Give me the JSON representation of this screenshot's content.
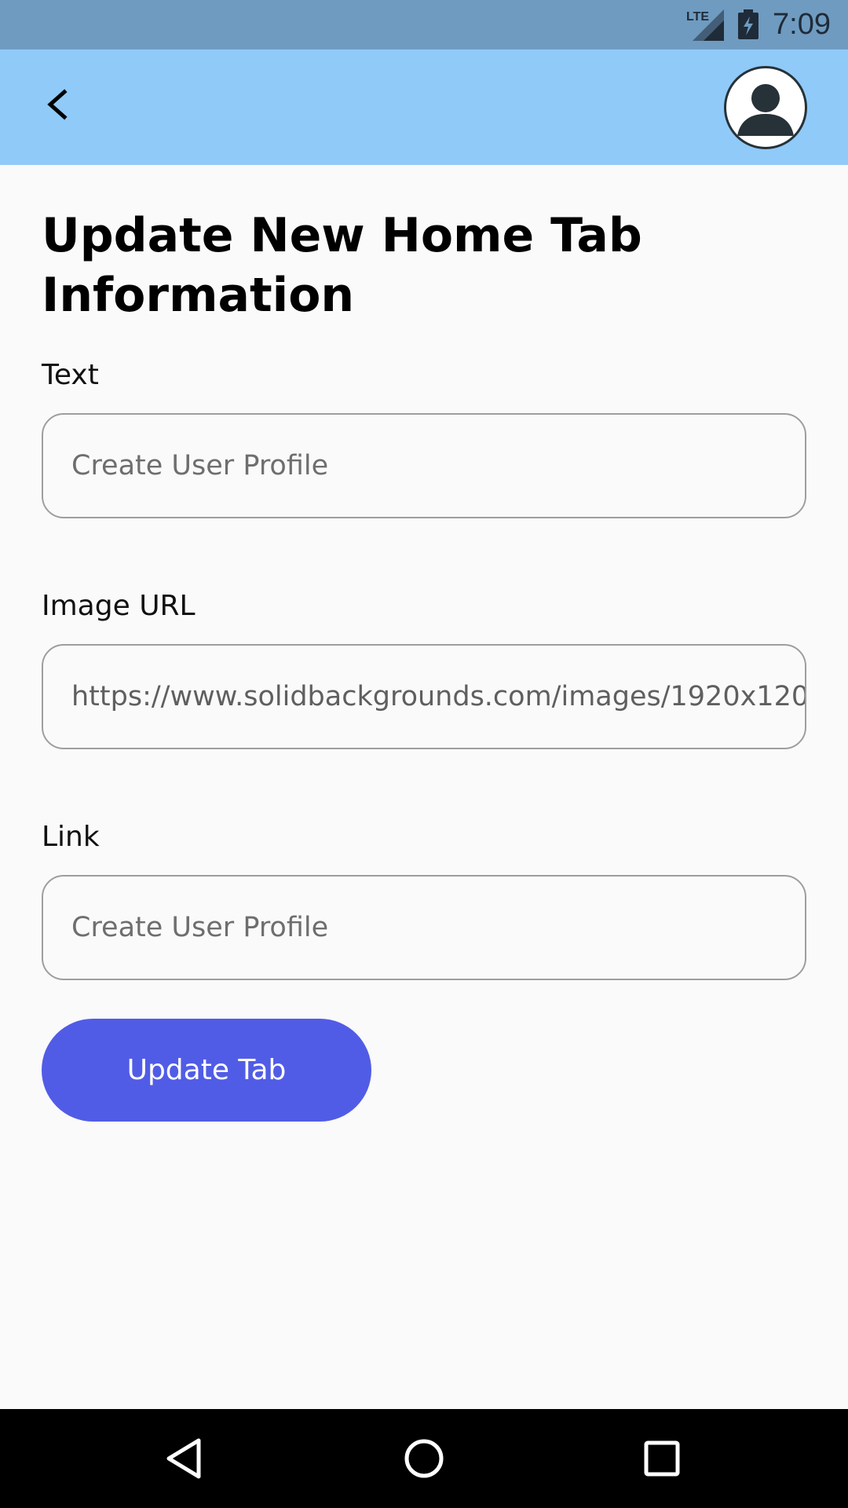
{
  "status_bar": {
    "time": "7:09",
    "network_label": "LTE",
    "icons": [
      "lte-signal-icon",
      "battery-charging-icon"
    ]
  },
  "app_bar": {
    "background": "#90caf9",
    "back_icon": "chevron-left-icon",
    "avatar_icon": "user-avatar-icon"
  },
  "page": {
    "title": "Update New Home Tab Information"
  },
  "form": {
    "text": {
      "label": "Text",
      "value": "",
      "placeholder": "Create User Profile"
    },
    "image_url": {
      "label": "Image URL",
      "value": "https://www.solidbackgrounds.com/images/1920x120",
      "placeholder": ""
    },
    "link": {
      "label": "Link",
      "value": "",
      "placeholder": "Create User Profile"
    },
    "submit_label": "Update Tab"
  },
  "colors": {
    "status_bar": "#6f9bc0",
    "accent": "#515ce6",
    "background": "#fafafa"
  },
  "nav_bar": {
    "icons": [
      "nav-back-icon",
      "nav-home-icon",
      "nav-recents-icon"
    ]
  }
}
